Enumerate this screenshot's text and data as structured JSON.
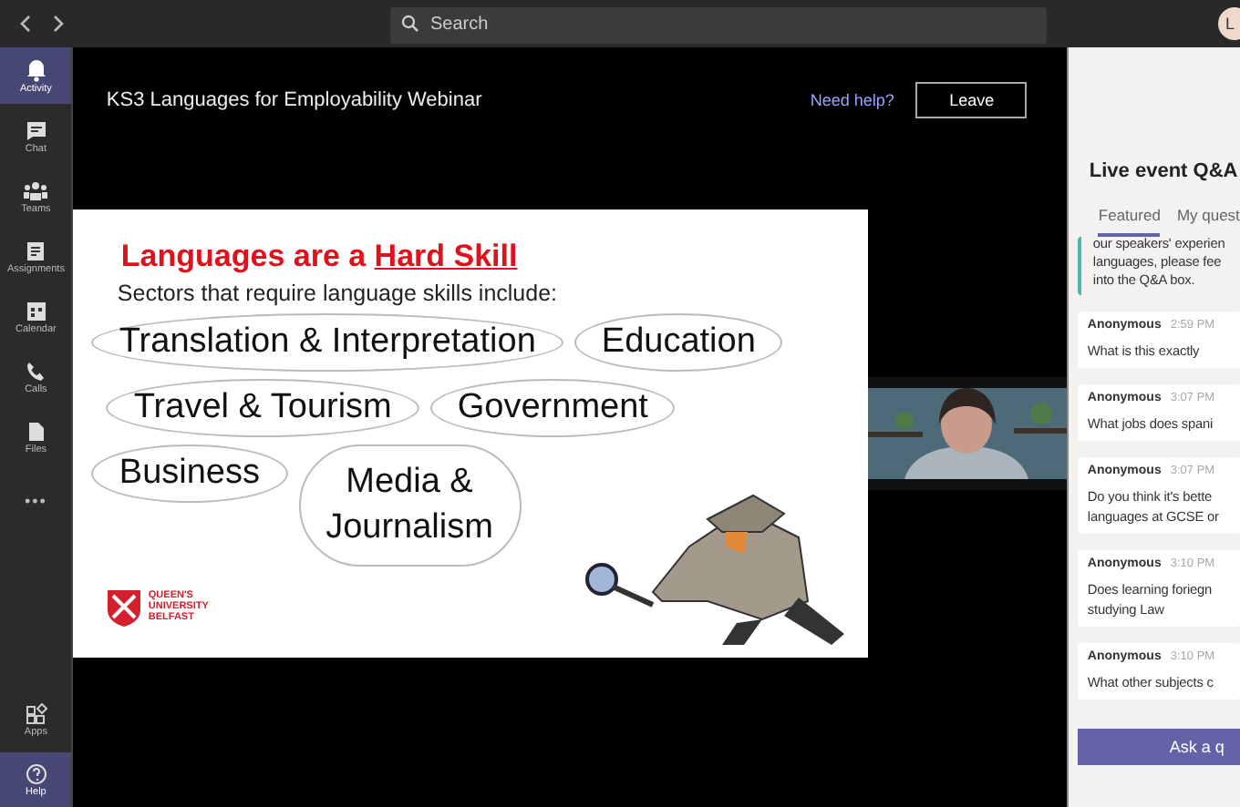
{
  "top_bar": {
    "search": {
      "placeholder": "Search"
    },
    "avatar": "L"
  },
  "rail": {
    "items": [
      {
        "label": "Activity",
        "selected": true
      },
      {
        "label": "Chat",
        "selected": false
      },
      {
        "label": "Teams",
        "selected": false
      },
      {
        "label": "Assignments",
        "selected": false
      },
      {
        "label": "Calendar",
        "selected": false
      },
      {
        "label": "Calls",
        "selected": false
      },
      {
        "label": "Files",
        "selected": false
      },
      {
        "label": "•••",
        "selected": false
      }
    ],
    "bottom": [
      {
        "label": "Apps",
        "selected": false
      },
      {
        "label": "Help",
        "selected": true
      }
    ]
  },
  "event": {
    "title": "KS3 Languages for Employability Webinar",
    "help_link": "Need help?",
    "leave_button": "Leave"
  },
  "slide": {
    "heading": "Languages are a **Hard Skill**",
    "subheading": "Sectors that require language skills include:",
    "rows": [
      [
        "Translation & Interpretation",
        "Education"
      ],
      [
        "Travel & Tourism",
        "Government"
      ],
      [
        "Business",
        "Media & Journalism"
      ]
    ],
    "logo": [
      "QUEEN'S",
      "UNIVERSITY",
      "BELFAST"
    ]
  },
  "qa": {
    "title": "Live event Q&A",
    "tabs": [
      {
        "label": "Featured",
        "selected": true
      },
      {
        "label": "My quest",
        "selected": false
      }
    ],
    "messages": [
      {
        "pinned": true,
        "lines": [
          "our speakers' experien",
          "languages, please fee",
          "into the Q&A box."
        ]
      },
      {
        "author": "Anonymous",
        "time": "2:59 PM",
        "pinned": false,
        "lines": [
          "What is this exactly"
        ]
      },
      {
        "author": "Anonymous",
        "time": "3:07 PM",
        "pinned": false,
        "lines": [
          "What jobs does spani"
        ]
      },
      {
        "author": "Anonymous",
        "time": "3:07 PM",
        "pinned": false,
        "lines": [
          "Do you think it's bette",
          "languages at GCSE or"
        ]
      },
      {
        "author": "Anonymous",
        "time": "3:10 PM",
        "pinned": false,
        "lines": [
          "Does learning foriegn",
          "studying Law"
        ]
      },
      {
        "author": "Anonymous",
        "time": "3:10 PM",
        "pinned": false,
        "lines": [
          "What other subjects c"
        ]
      }
    ],
    "ask_button": "Ask a q"
  }
}
